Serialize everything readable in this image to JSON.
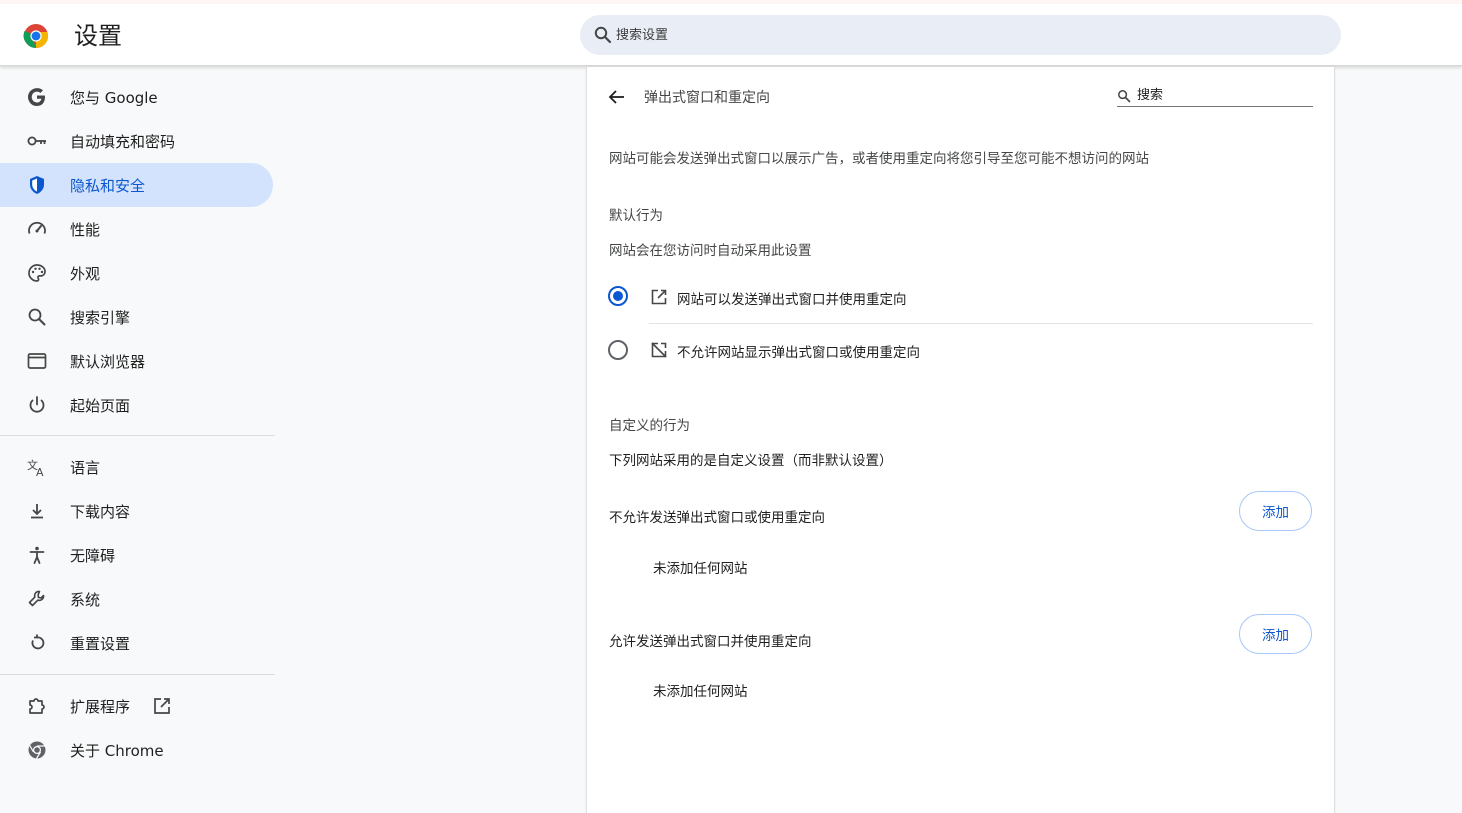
{
  "header": {
    "title": "设置",
    "search_placeholder": "搜索设置"
  },
  "sidebar": {
    "items": [
      {
        "label": "您与 Google",
        "icon": "google-g-icon"
      },
      {
        "label": "自动填充和密码",
        "icon": "key-icon"
      },
      {
        "label": "隐私和安全",
        "icon": "shield-icon",
        "active": true
      },
      {
        "label": "性能",
        "icon": "speedometer-icon"
      },
      {
        "label": "外观",
        "icon": "palette-icon"
      },
      {
        "label": "搜索引擎",
        "icon": "search-icon"
      },
      {
        "label": "默认浏览器",
        "icon": "browser-window-icon"
      },
      {
        "label": "起始页面",
        "icon": "power-icon"
      },
      {
        "label": "语言",
        "icon": "translate-icon"
      },
      {
        "label": "下载内容",
        "icon": "download-icon"
      },
      {
        "label": "无障碍",
        "icon": "accessibility-icon"
      },
      {
        "label": "系统",
        "icon": "wrench-icon"
      },
      {
        "label": "重置设置",
        "icon": "reset-icon"
      },
      {
        "label": "扩展程序",
        "icon": "puzzle-icon"
      },
      {
        "label": "关于 Chrome",
        "icon": "chrome-icon"
      }
    ]
  },
  "content": {
    "title": "弹出式窗口和重定向",
    "search_placeholder": "搜索",
    "description": "网站可能会发送弹出式窗口以展示广告，或者使用重定向将您引导至您可能不想访问的网站",
    "default_behavior": {
      "heading": "默认行为",
      "subtitle": "网站会在您访问时自动采用此设置",
      "options": [
        {
          "label": "网站可以发送弹出式窗口并使用重定向",
          "icon": "open-in-new-icon",
          "checked": true
        },
        {
          "label": "不允许网站显示弹出式窗口或使用重定向",
          "icon": "popup-blocked-icon",
          "checked": false
        }
      ]
    },
    "custom_behavior": {
      "heading": "自定义的行为",
      "subtitle": "下列网站采用的是自定义设置（而非默认设置）",
      "sections": [
        {
          "label": "不允许发送弹出式窗口或使用重定向",
          "button": "添加",
          "empty": "未添加任何网站"
        },
        {
          "label": "允许发送弹出式窗口并使用重定向",
          "button": "添加",
          "empty": "未添加任何网站"
        }
      ]
    }
  },
  "colors": {
    "accent": "#0b57d0",
    "active_nav_bg": "#d3e3fd",
    "search_bg": "#e9eef6"
  }
}
